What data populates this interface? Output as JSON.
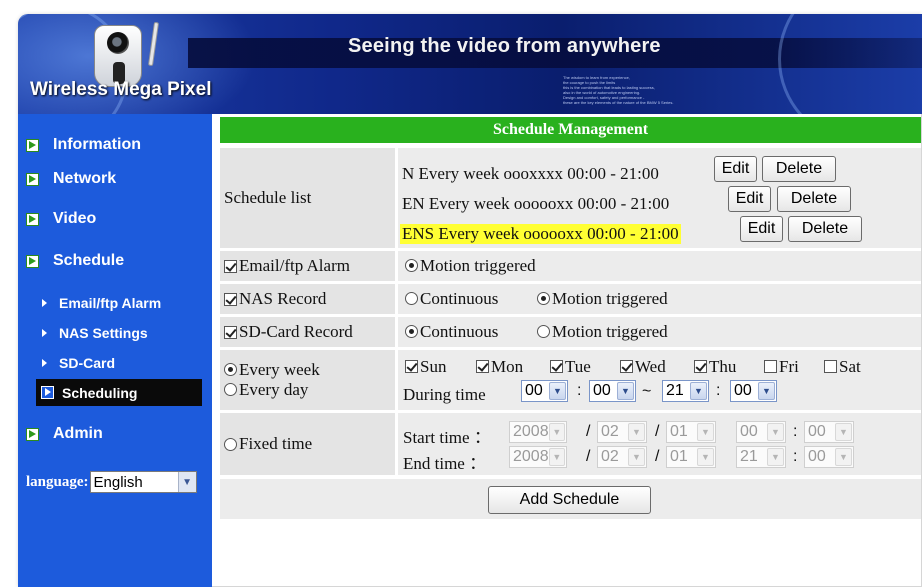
{
  "header": {
    "title": "Seeing the video from anywhere",
    "brand": "Wireless Mega Pixel",
    "blurb": [
      "The wisdom to learn from experience,",
      "the courage to push the limits",
      "this is the combination that leads to lasting success,",
      "also in the world of automotive engineering.",
      "Design and comfort, safety and performance -",
      "these are the key elements of the nature of the BMW 5 Series."
    ]
  },
  "sidebar": {
    "items": [
      {
        "label": "Information"
      },
      {
        "label": "Network"
      },
      {
        "label": "Video"
      },
      {
        "label": "Schedule"
      }
    ],
    "subitems": [
      {
        "label": "Email/ftp Alarm"
      },
      {
        "label": "NAS Settings"
      },
      {
        "label": "SD-Card"
      },
      {
        "label": "Scheduling",
        "active": true
      }
    ],
    "admin": "Admin",
    "language_label": "language:",
    "language_value": "English"
  },
  "main": {
    "heading": "Schedule Management",
    "schedule_list_label": "Schedule list",
    "schedules": [
      {
        "text": "N Every week oooxxxx 00:00 - 21:00",
        "highlighted": false
      },
      {
        "text": "EN Every week oooooxx 00:00 - 21:00",
        "highlighted": false
      },
      {
        "text": "ENS Every week oooooxx 00:00 - 21:00",
        "highlighted": true
      }
    ],
    "edit_label": "Edit",
    "delete_label": "Delete",
    "email_label": "Email/ftp Alarm",
    "nas_label": "NAS Record",
    "sd_label": "SD-Card Record",
    "motion_label": "Motion triggered",
    "continuous_label": "Continuous",
    "every_week": "Every week",
    "every_day": "Every day",
    "days": [
      "Sun",
      "Mon",
      "Tue",
      "Wed",
      "Thu",
      "Fri",
      "Sat"
    ],
    "days_checked": [
      true,
      true,
      true,
      true,
      true,
      false,
      false
    ],
    "during_time": "During time",
    "during": {
      "h1": "00",
      "m1": "00",
      "tilde": "~",
      "h2": "21",
      "m2": "00",
      "colon": ":"
    },
    "fixed_time": "Fixed time",
    "start_time": "Start time ：",
    "end_time": "End time ：",
    "start": {
      "year": "2008",
      "month": "02",
      "day": "01",
      "hour": "00",
      "minute": "00"
    },
    "end": {
      "year": "2008",
      "month": "02",
      "day": "01",
      "hour": "21",
      "minute": "00"
    },
    "slash": "/",
    "add_schedule": "Add Schedule"
  }
}
